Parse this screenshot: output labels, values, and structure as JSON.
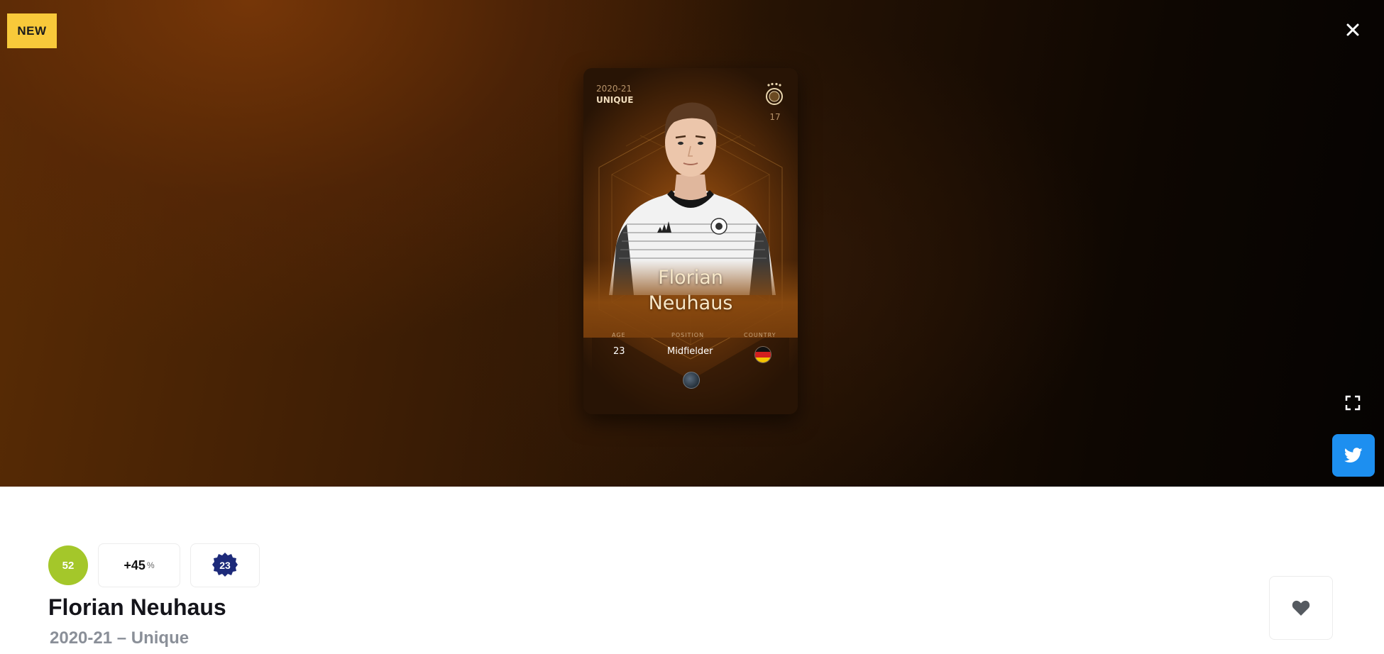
{
  "badge": {
    "new_label": "NEW"
  },
  "card": {
    "season": "2020-21",
    "rarity": "UNIQUE",
    "shirt_number": "17",
    "first_name": "Florian",
    "last_name": "Neuhaus",
    "stats": {
      "age_label": "AGE",
      "age_value": "23",
      "position_label": "POSITION",
      "position_value": "Midfielder",
      "country_label": "COUNTRY"
    }
  },
  "info": {
    "score": "52",
    "score_color": "#a4c72a",
    "percent_value": "+45",
    "percent_sign": "%",
    "seal_number": "23",
    "title": "Florian Neuhaus",
    "subtitle": "2020-21 – Unique"
  },
  "icons": {
    "close": "close-icon",
    "fullscreen": "fullscreen-icon",
    "twitter": "twitter-icon",
    "heart": "heart-icon"
  },
  "colors": {
    "twitter_blue": "#1d8ff0",
    "new_badge": "#f8c93a"
  }
}
